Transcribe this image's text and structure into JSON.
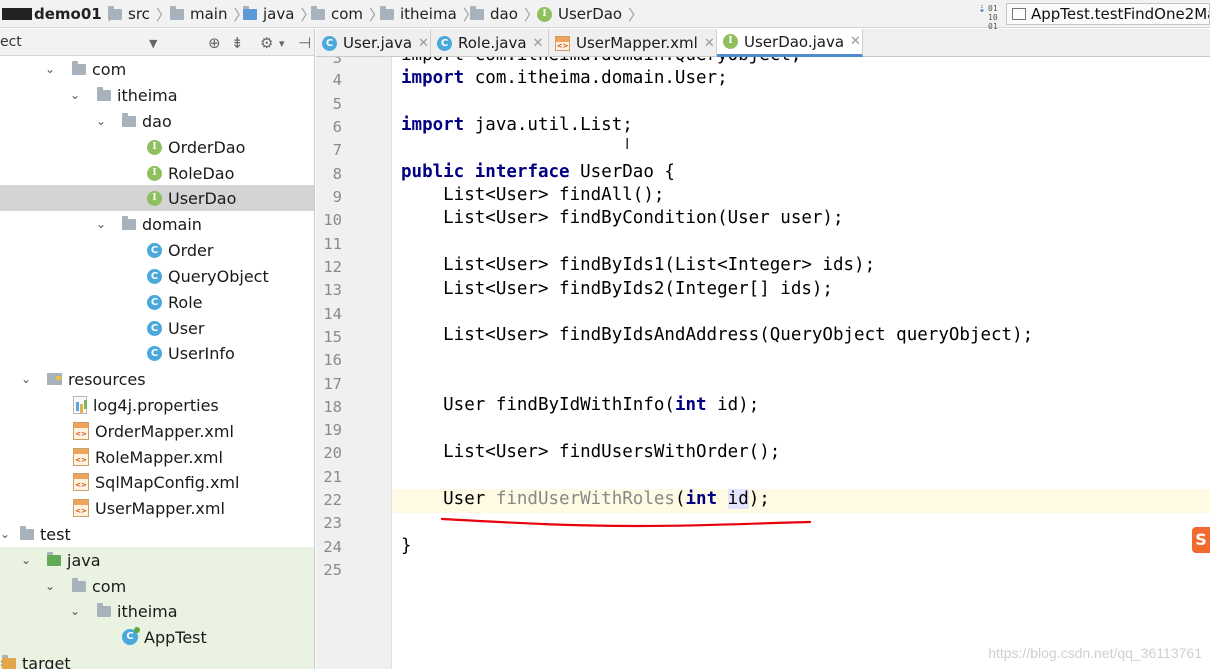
{
  "breadcrumb": {
    "items": [
      "demo01",
      "src",
      "main",
      "java",
      "com",
      "itheima",
      "dao",
      "UserDao"
    ]
  },
  "run_config": {
    "label": "AppTest.testFindOne2Ma"
  },
  "project_panel": {
    "header_label": "ect"
  },
  "tree": [
    {
      "label": "com"
    },
    {
      "label": "itheima"
    },
    {
      "label": "dao"
    },
    {
      "label": "OrderDao"
    },
    {
      "label": "RoleDao"
    },
    {
      "label": "UserDao"
    },
    {
      "label": "domain"
    },
    {
      "label": "Order"
    },
    {
      "label": "QueryObject"
    },
    {
      "label": "Role"
    },
    {
      "label": "User"
    },
    {
      "label": "UserInfo"
    },
    {
      "label": "resources"
    },
    {
      "label": "log4j.properties"
    },
    {
      "label": "OrderMapper.xml"
    },
    {
      "label": "RoleMapper.xml"
    },
    {
      "label": "SqlMapConfig.xml"
    },
    {
      "label": "UserMapper.xml"
    },
    {
      "label": "test"
    },
    {
      "label": "java"
    },
    {
      "label": "com"
    },
    {
      "label": "itheima"
    },
    {
      "label": "AppTest"
    },
    {
      "label": "target"
    }
  ],
  "tabs": [
    {
      "label": "User.java"
    },
    {
      "label": "Role.java"
    },
    {
      "label": "UserMapper.xml"
    },
    {
      "label": "UserDao.java"
    }
  ],
  "editor": {
    "line_numbers": [
      "4",
      "5",
      "6",
      "7",
      "8",
      "9",
      "10",
      "11",
      "12",
      "13",
      "14",
      "15",
      "16",
      "17",
      "18",
      "19",
      "20",
      "21",
      "22",
      "23",
      "24",
      "25"
    ],
    "top_partial_line": "import com.itheima.domain.QueryObject;",
    "lines": {
      "l4_kw": "import",
      "l4_rest": " com.itheima.domain.User;",
      "l6_kw": "import",
      "l6_rest": " java.util.List;",
      "l8_kw1": "public",
      "l8_kw2": "interface",
      "l8_rest": " UserDao {",
      "l9": "    List<User> findAll();",
      "l10": "    List<User> findByCondition(User user);",
      "l12": "    List<User> findByIds1(List<Integer> ids);",
      "l13": "    List<User> findByIds2(Integer[] ids);",
      "l15": "    List<User> findByIdsAndAddress(QueryObject queryObject);",
      "l18_pre": "    User findByIdWithInfo(",
      "l18_kw": "int",
      "l18_post": " id);",
      "l20": "    List<User> findUsersWithOrder();",
      "l22_pre": "    User ",
      "l22_fn": "findUserWithRoles",
      "l22_paren": "(",
      "l22_kw": "int",
      "l22_sp": " ",
      "l22_id": "id",
      "l22_post": ");",
      "l24": "}"
    }
  },
  "watermark": "https://blog.csdn.net/qq_36113761",
  "badge": "S",
  "colors": {
    "keyword": "#000080",
    "annotation": "#e8000b",
    "selection": "#d4d4d4"
  }
}
